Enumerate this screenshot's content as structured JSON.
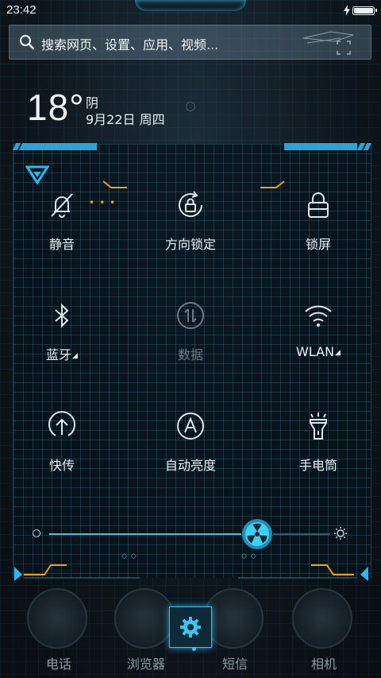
{
  "status_bar": {
    "time": "23:42",
    "battery_level": 1.0,
    "charging_icon": "bolt-icon"
  },
  "search": {
    "placeholder": "搜索网页、设置、应用、视频..."
  },
  "weather": {
    "temperature": "18°",
    "condition": "阴",
    "date": "9月22日 周四"
  },
  "quick_settings": {
    "tiles": [
      {
        "label": "静音",
        "icon": "bell-off-icon",
        "enabled": true
      },
      {
        "label": "方向锁定",
        "icon": "rotation-lock-icon",
        "enabled": true
      },
      {
        "label": "锁屏",
        "icon": "lock-icon",
        "enabled": true
      },
      {
        "label": "蓝牙",
        "icon": "bluetooth-icon",
        "enabled": true,
        "expandable": true
      },
      {
        "label": "数据",
        "icon": "mobile-data-icon",
        "enabled": false
      },
      {
        "label": "WLAN",
        "icon": "wifi-icon",
        "enabled": true,
        "expandable": true
      },
      {
        "label": "快传",
        "icon": "quick-transfer-icon",
        "enabled": true
      },
      {
        "label": "自动亮度",
        "icon": "auto-brightness-icon",
        "enabled": true
      },
      {
        "label": "手电筒",
        "icon": "flashlight-icon",
        "enabled": true
      }
    ],
    "brightness_level": 0.74
  },
  "dock": {
    "items": [
      {
        "label": "电话",
        "icon": "phone-icon"
      },
      {
        "label": "浏览器",
        "icon": "browser-icon"
      },
      {
        "label": "短信",
        "icon": "message-icon"
      },
      {
        "label": "相机",
        "icon": "camera-icon"
      }
    ],
    "settings_icon": "gear-icon"
  },
  "colors": {
    "accent_cyan": "#2aa4d8",
    "accent_orange": "#e0a420",
    "panel_bg": "#08121a"
  }
}
